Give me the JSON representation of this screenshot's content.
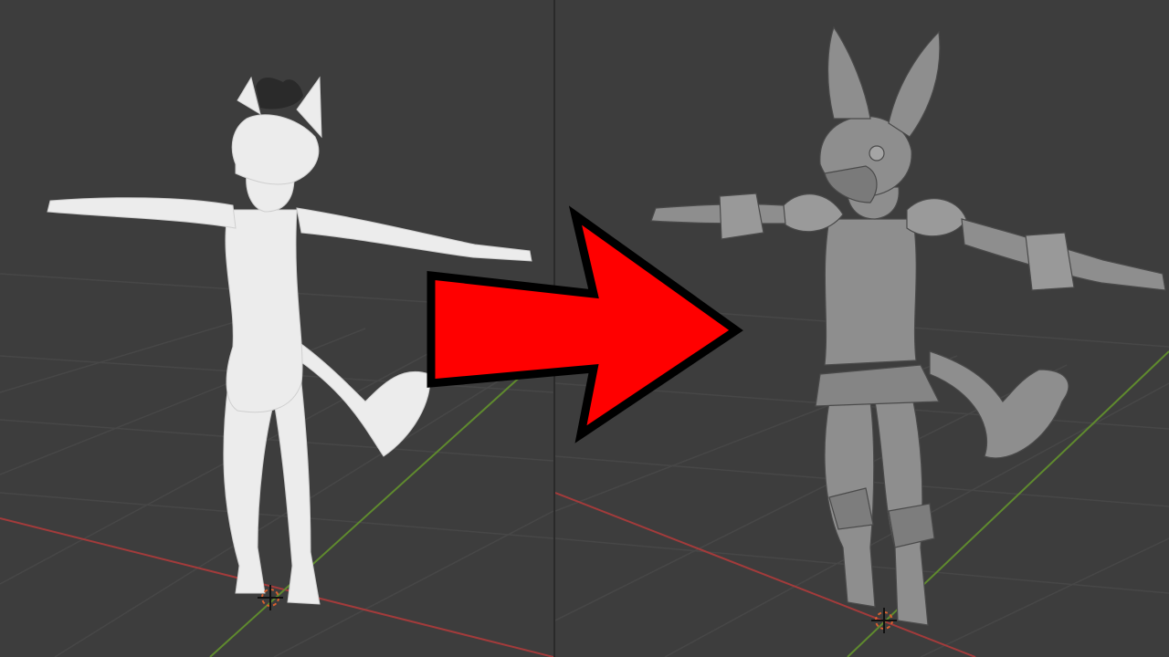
{
  "viewports": [
    {
      "name": "before",
      "model_shading": "white",
      "model_color": "#ececec",
      "model_shadow": "#c9c9c9",
      "hair_color": "#2a2a2a"
    },
    {
      "name": "after",
      "model_shading": "solid-gray",
      "model_color": "#8e8e8e",
      "model_shadow": "#6a6a6a",
      "line_color": "#4a4a4a"
    }
  ],
  "viewport_colors": {
    "background": "#3d3d3d",
    "grid": "#474747",
    "x_axis": "#a33b3b",
    "y_axis": "#5f8a2e",
    "cursor": "#d9602f"
  },
  "arrow": {
    "icon": "right-arrow-icon",
    "fill": "#ff0000",
    "outline": "#000000"
  }
}
